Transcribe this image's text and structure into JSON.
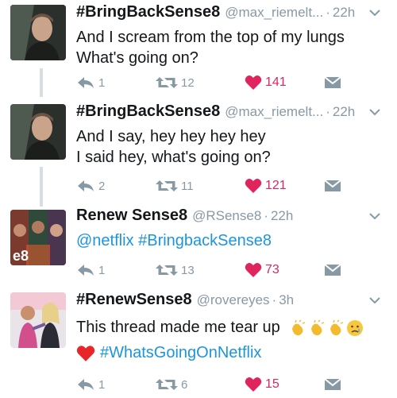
{
  "tweets": [
    {
      "name": "#BringBackSense8",
      "handle": "@max_riemelt...",
      "separator": "·",
      "time": "22h",
      "lines": [
        "And I scream from the top of my lungs",
        "What's going on?"
      ],
      "replies": "1",
      "retweets": "12",
      "likes": "141"
    },
    {
      "name": "#BringBackSense8",
      "handle": "@max_riemelt...",
      "separator": "·",
      "time": "22h",
      "lines": [
        "And I say, hey hey hey hey",
        "I said hey, what's going on?"
      ],
      "replies": "2",
      "retweets": "11",
      "likes": "121"
    },
    {
      "name": "Renew Sense8",
      "handle": "@RSense8",
      "separator": "·",
      "time": "22h",
      "link_text": "@netflix #BringbackSense8",
      "avatar_text": "e8",
      "replies": "1",
      "retweets": "13",
      "likes": "73"
    },
    {
      "name": "#RenewSense8",
      "handle": "@rovereyes",
      "separator": "·",
      "time": "3h",
      "line1": "This thread made me tear up",
      "hashtag": "#WhatsGoingOnNetflix",
      "replies": "1",
      "retweets": "6",
      "likes": "15"
    }
  ],
  "icons": {
    "reply": "reply-icon",
    "retweet": "retweet-icon",
    "like": "heart-icon",
    "dm": "envelope-icon",
    "caret": "chevron-down-icon"
  },
  "colors": {
    "text": "#14171a",
    "muted": "#8899a6",
    "link": "#1b95e0",
    "like": "#e0245e",
    "thread_line": "#d8dde2"
  }
}
